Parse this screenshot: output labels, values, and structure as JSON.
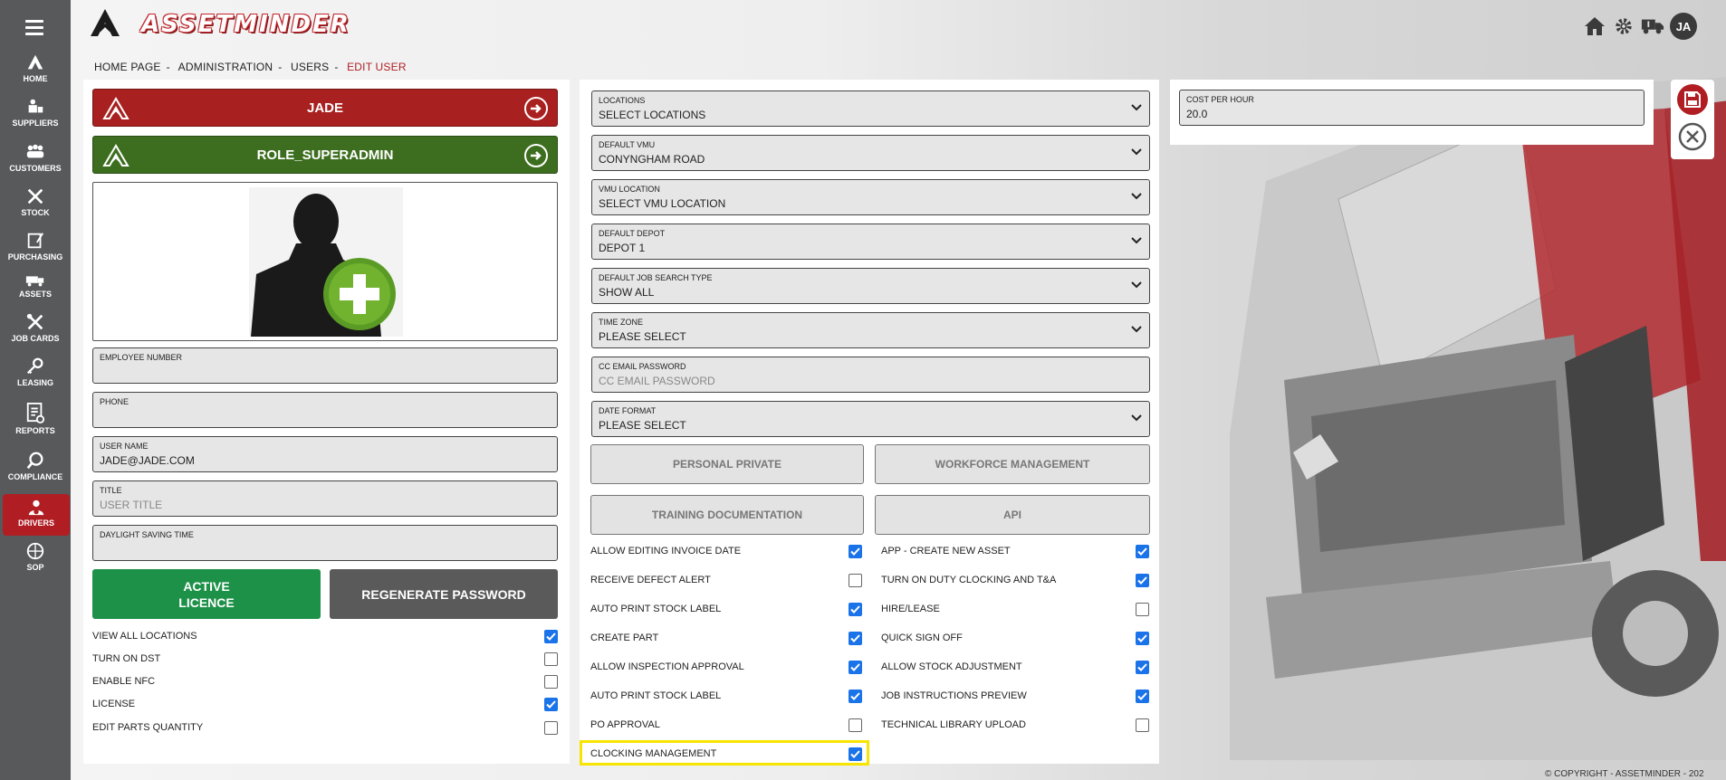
{
  "app": {
    "logo_text": "ASSETMINDER",
    "user_initials": "JA",
    "copyright": "© COPYRIGHT - ASSETMINDER - 202"
  },
  "sidebar": {
    "items": [
      {
        "label": "HOME",
        "icon": "home-icon"
      },
      {
        "label": "SUPPLIERS",
        "icon": "suppliers-icon"
      },
      {
        "label": "CUSTOMERS",
        "icon": "customers-icon"
      },
      {
        "label": "STOCK",
        "icon": "stock-icon"
      },
      {
        "label": "PURCHASING",
        "icon": "purchasing-icon"
      },
      {
        "label": "ASSETS",
        "icon": "assets-icon"
      },
      {
        "label": "JOB CARDS",
        "icon": "job-cards-icon"
      },
      {
        "label": "LEASING",
        "icon": "leasing-icon"
      },
      {
        "label": "REPORTS",
        "icon": "reports-icon"
      },
      {
        "label": "COMPLIANCE",
        "icon": "compliance-icon"
      },
      {
        "label": "DRIVERS",
        "icon": "drivers-icon"
      },
      {
        "label": "SOP",
        "icon": "sop-icon"
      }
    ]
  },
  "breadcrumb": [
    "HOME PAGE",
    "ADMINISTRATION",
    "USERS",
    "EDIT USER"
  ],
  "left": {
    "name_banner": "JADE",
    "role_banner": "ROLE_SUPERADMIN",
    "fields": [
      {
        "label": "EMPLOYEE NUMBER",
        "value": "",
        "placeholder": ""
      },
      {
        "label": "PHONE",
        "value": "",
        "placeholder": ""
      },
      {
        "label": "USER NAME",
        "value": "JADE@JADE.COM",
        "placeholder": ""
      },
      {
        "label": "TITLE",
        "value": "",
        "placeholder": "USER TITLE"
      },
      {
        "label": "DAYLIGHT SAVING TIME",
        "value": "",
        "placeholder": ""
      }
    ],
    "active_licence_line1": "ACTIVE",
    "active_licence_line2": "LICENCE",
    "regenerate_password": "REGENERATE PASSWORD",
    "checks": [
      {
        "label": "VIEW ALL LOCATIONS",
        "checked": true
      },
      {
        "label": "TURN ON DST",
        "checked": false
      },
      {
        "label": "ENABLE NFC",
        "checked": false
      },
      {
        "label": "LICENSE",
        "checked": true
      },
      {
        "label": "EDIT PARTS QUANTITY",
        "checked": false
      }
    ]
  },
  "middle": {
    "selects": [
      {
        "label": "LOCATIONS",
        "value": "SELECT LOCATIONS"
      },
      {
        "label": "DEFAULT VMU",
        "value": "CONYNGHAM ROAD"
      },
      {
        "label": "VMU LOCATION",
        "value": "SELECT VMU LOCATION"
      },
      {
        "label": "DEFAULT DEPOT",
        "value": "DEPOT 1"
      },
      {
        "label": "DEFAULT JOB SEARCH TYPE",
        "value": "SHOW ALL"
      },
      {
        "label": "TIME ZONE",
        "value": "PLEASE SELECT"
      },
      {
        "label": "CC EMAIL PASSWORD",
        "value": "",
        "placeholder": "CC EMAIL PASSWORD"
      },
      {
        "label": "DATE FORMAT",
        "value": "PLEASE SELECT"
      }
    ],
    "buttons": [
      "PERSONAL PRIVATE",
      "WORKFORCE MANAGEMENT",
      "TRAINING DOCUMENTATION",
      "API"
    ],
    "checks_left": [
      {
        "label": "ALLOW EDITING INVOICE DATE",
        "checked": true
      },
      {
        "label": "RECEIVE DEFECT ALERT",
        "checked": false
      },
      {
        "label": "AUTO PRINT STOCK LABEL",
        "checked": true
      },
      {
        "label": "CREATE PART",
        "checked": true
      },
      {
        "label": "ALLOW INSPECTION APPROVAL",
        "checked": true
      },
      {
        "label": "AUTO PRINT STOCK LABEL",
        "checked": true
      },
      {
        "label": "PO APPROVAL",
        "checked": false
      },
      {
        "label": "CLOCKING MANAGEMENT",
        "checked": true
      }
    ],
    "checks_right": [
      {
        "label": "APP - CREATE NEW ASSET",
        "checked": true
      },
      {
        "label": "TURN ON DUTY CLOCKING AND T&A",
        "checked": true
      },
      {
        "label": "HIRE/LEASE",
        "checked": false
      },
      {
        "label": "QUICK SIGN OFF",
        "checked": true
      },
      {
        "label": "ALLOW STOCK ADJUSTMENT",
        "checked": true
      },
      {
        "label": "JOB INSTRUCTIONS PREVIEW",
        "checked": true
      },
      {
        "label": "TECHNICAL LIBRARY UPLOAD",
        "checked": false
      }
    ]
  },
  "right": {
    "cost_label": "COST PER HOUR",
    "cost_value": "20.0"
  },
  "colors": {
    "brand_red": "#b01e23",
    "banner_green": "#3d6e1f",
    "active_green": "#1e9148",
    "check_blue": "#1a73e8",
    "highlight": "#f7e400"
  }
}
